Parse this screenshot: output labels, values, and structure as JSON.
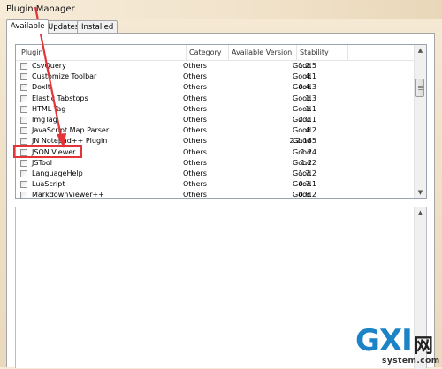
{
  "window": {
    "title": "Plugin Manager"
  },
  "tabs": [
    {
      "label": "Available",
      "active": true
    },
    {
      "label": "Updates",
      "active": false
    },
    {
      "label": "Installed",
      "active": false
    }
  ],
  "columns": {
    "plugin": "Plugin",
    "category": "Category",
    "version": "Available Version",
    "stability": "Stability"
  },
  "plugins": [
    {
      "name": "CsvQuery",
      "category": "Others",
      "version": "1.2.5",
      "stability": "Good"
    },
    {
      "name": "Customize Toolbar",
      "category": "Others",
      "version": "4.1",
      "stability": "Good"
    },
    {
      "name": "DoxIt",
      "category": "Others",
      "version": "0.4.3",
      "stability": "Good"
    },
    {
      "name": "Elastic Tabstops",
      "category": "Others",
      "version": "1.3",
      "stability": "Good"
    },
    {
      "name": "HTML Tag",
      "category": "Others",
      "version": "1.1",
      "stability": "Good"
    },
    {
      "name": "ImgTag",
      "category": "Others",
      "version": "2.0.1",
      "stability": "Good"
    },
    {
      "name": "JavaScript Map Parser",
      "category": "Others",
      "version": "4.2",
      "stability": "Good"
    },
    {
      "name": "JN Notepad++ Plugin",
      "category": "Others",
      "version": "2.2.185",
      "stability": "Good"
    },
    {
      "name": "JSON Viewer",
      "category": "Others",
      "version": "1.24",
      "stability": "Good"
    },
    {
      "name": "JSTool",
      "category": "Others",
      "version": "1.22",
      "stability": "Good"
    },
    {
      "name": "LanguageHelp",
      "category": "Others",
      "version": "1.7.2",
      "stability": "Good"
    },
    {
      "name": "LuaScript",
      "category": "Others",
      "version": "0.7.1",
      "stability": "Good"
    },
    {
      "name": "MarkdownViewer++",
      "category": "Others",
      "version": "0.8.2",
      "stability": "Good"
    }
  ],
  "scroll": {
    "up_glyph": "▲",
    "down_glyph": "▼"
  },
  "annotation": {
    "highlight_color": "#e3343a",
    "highlighted_item": "JSON Viewer"
  },
  "watermark": {
    "logo": "GXI",
    "chinese": "网",
    "site": "system.com"
  }
}
